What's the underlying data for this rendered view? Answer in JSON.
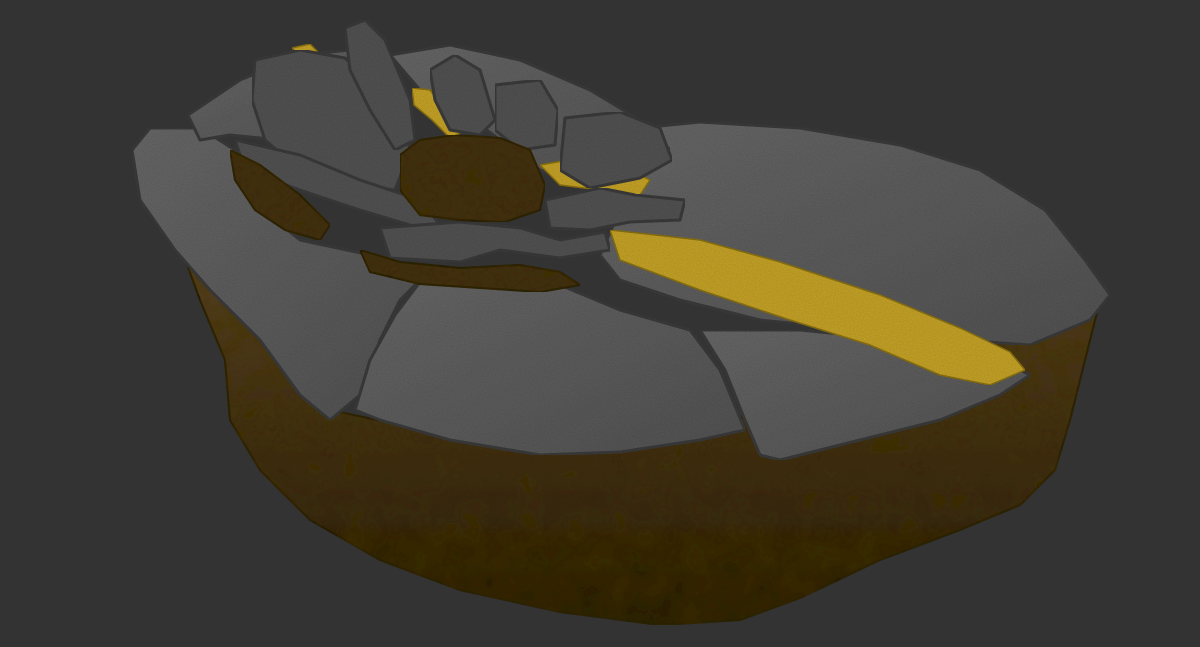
{
  "scene": {
    "subject": "broken-asphalt-road-chunk-3d-sculpt",
    "colors": {
      "background": "#333333",
      "asphalt_light": "#6a6a6a",
      "asphalt_mid": "#555555",
      "asphalt_dark": "#3e3e3e",
      "road_marking": "#c9a62a",
      "road_marking_dark": "#8f7518",
      "dirt_light": "#5a4424",
      "dirt_mid": "#3f2e17",
      "dirt_dark": "#241a0c"
    }
  }
}
